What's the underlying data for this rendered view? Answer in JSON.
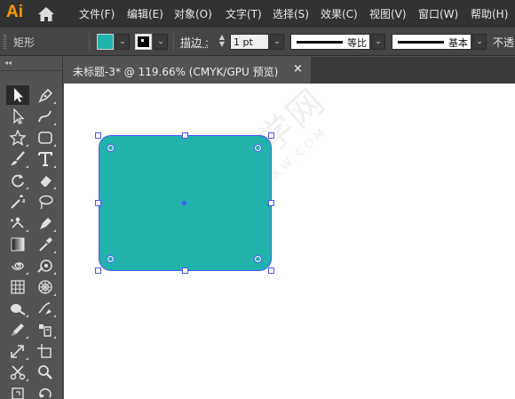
{
  "app": {
    "logo": "Ai"
  },
  "menu": [
    "文件(F)",
    "编辑(E)",
    "对象(O)",
    "文字(T)",
    "选择(S)",
    "效果(C)",
    "视图(V)",
    "窗口(W)",
    "帮助(H)"
  ],
  "control": {
    "shape_label": "矩形",
    "fill_color": "#22b2ac",
    "stroke_label": "描边 :",
    "stroke_weight": "1 pt",
    "variable_width_profile": "等比",
    "brush_definition": "基本",
    "opacity_label": "不透"
  },
  "document": {
    "tab_title": "未标题-3* @ 119.66% (CMYK/GPU 预览)",
    "close_glyph": "×",
    "shape_color": "#22b2ac",
    "selection_color": "#4a57ff"
  },
  "watermark": {
    "main": "软件自学网",
    "sub": "WWW.RJZXW.COM"
  },
  "toolbar": {
    "collapse_glyph": "◂◂",
    "tools": [
      "selection-tool",
      "pen-tool",
      "direct-selection-tool",
      "curvature-tool",
      "star-tool",
      "rounded-rectangle-tool",
      "paintbrush-tool",
      "type-tool",
      "rotate-tool",
      "eraser-tool",
      "magic-wand-tool",
      "lasso-tool",
      "puppet-warp-tool",
      "fill-pen-tool",
      "gradient-tool",
      "eyedropper-tool",
      "twirl-tool",
      "shape-builder-tool",
      "grid-tool",
      "polar-grid-tool",
      "blob-brush-tool",
      "mesh-tool",
      "pencil-tool",
      "live-paint-tool",
      "scale-tool",
      "artboard-tool",
      "scissors-tool",
      "zoom-tool",
      "slice-tool",
      "rotate-view-tool"
    ]
  }
}
